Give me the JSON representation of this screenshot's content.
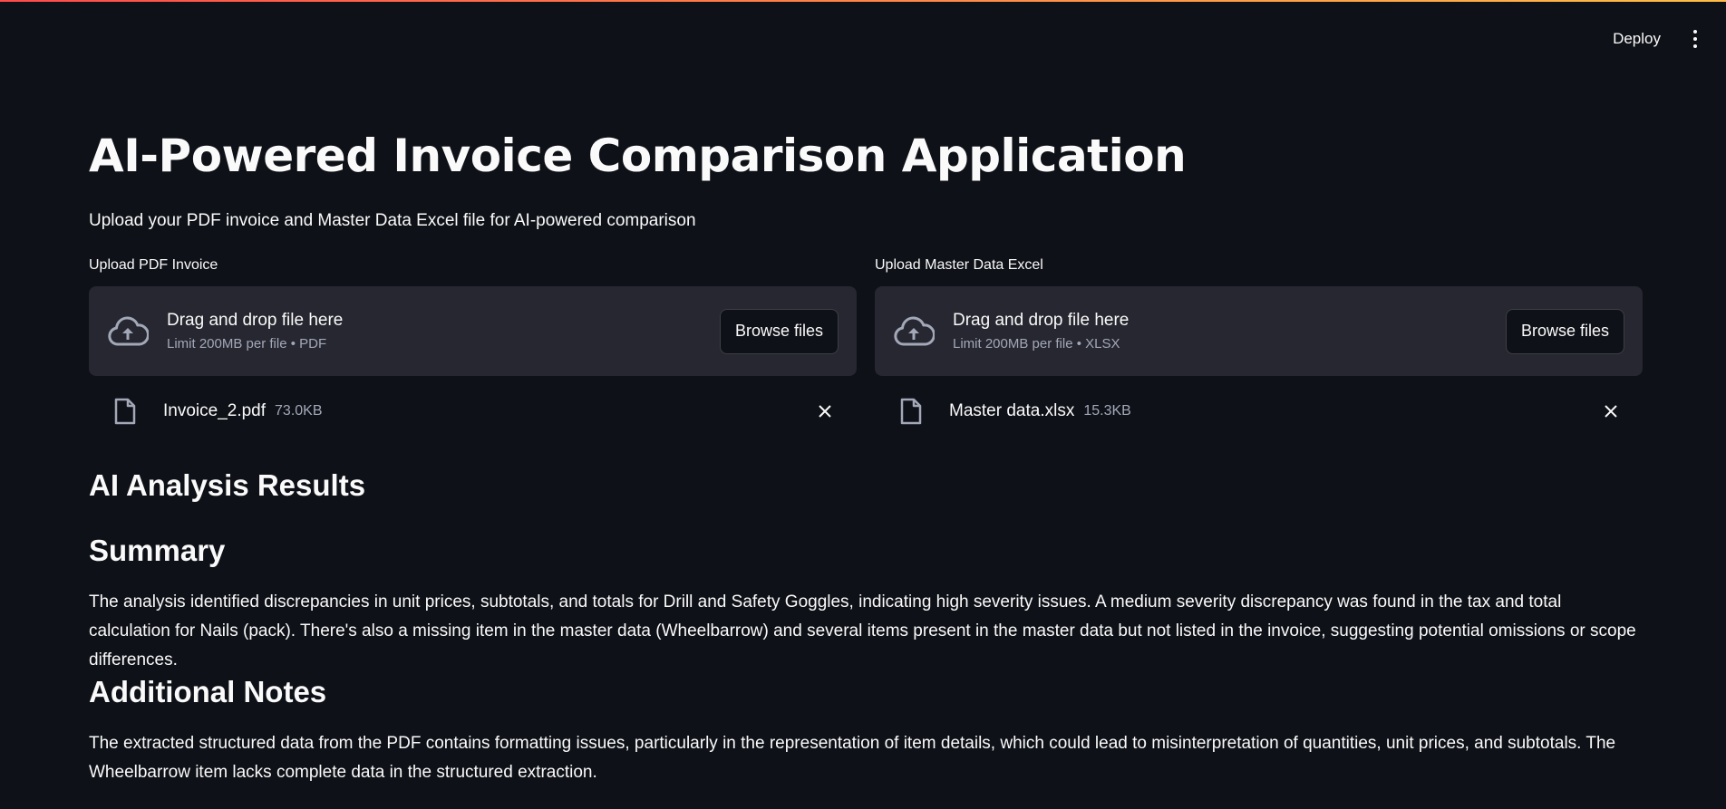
{
  "toolbar": {
    "deploy_label": "Deploy",
    "menu_icon": "vertical-ellipsis-icon"
  },
  "page": {
    "title": "AI-Powered Invoice Comparison Application",
    "subtitle": "Upload your PDF invoice and Master Data Excel file for AI-powered comparison"
  },
  "uploaders": [
    {
      "label": "Upload PDF Invoice",
      "drop_title": "Drag and drop file here",
      "drop_limit": "Limit 200MB per file • PDF",
      "browse_label": "Browse files",
      "file_name": "Invoice_2.pdf",
      "file_size": "73.0KB"
    },
    {
      "label": "Upload Master Data Excel",
      "drop_title": "Drag and drop file here",
      "drop_limit": "Limit 200MB per file • XLSX",
      "browse_label": "Browse files",
      "file_name": "Master data.xlsx",
      "file_size": "15.3KB"
    }
  ],
  "results": {
    "title": "AI Analysis Results",
    "summary_title": "Summary",
    "summary_text": "The analysis identified discrepancies in unit prices, subtotals, and totals for Drill and Safety Goggles, indicating high severity issues. A medium severity discrepancy was found in the tax and total calculation for Nails (pack). There's also a missing item in the master data (Wheelbarrow) and several items present in the master data but not listed in the invoice, suggesting potential omissions or scope differences.",
    "notes_title": "Additional Notes",
    "notes_text": "The extracted structured data from the PDF contains formatting issues, particularly in the representation of item details, which could lead to misinterpretation of quantities, unit prices, and subtotals. The Wheelbarrow item lacks complete data in the structured extraction."
  },
  "colors": {
    "background": "#0e1117",
    "dropzone": "#262730",
    "muted_text": "#a3a8b8",
    "accent_gradient_start": "#ff4b4b",
    "accent_gradient_end": "#ffbd45"
  }
}
